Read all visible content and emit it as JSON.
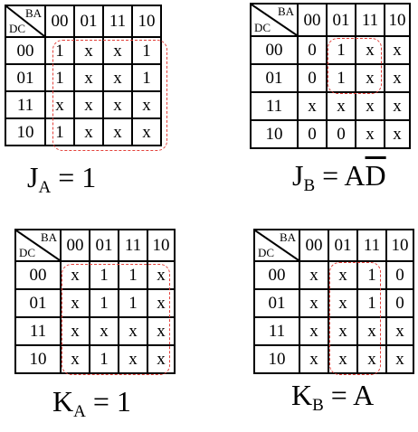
{
  "kmaps": [
    {
      "corner": {
        "top": "BA",
        "bottom": "DC"
      },
      "columns": [
        "00",
        "01",
        "11",
        "10"
      ],
      "rows": [
        {
          "label": "00",
          "cells": [
            "1",
            "x",
            "x",
            "1"
          ]
        },
        {
          "label": "01",
          "cells": [
            "1",
            "x",
            "x",
            "1"
          ]
        },
        {
          "label": "11",
          "cells": [
            "x",
            "x",
            "x",
            "x"
          ]
        },
        {
          "label": "10",
          "cells": [
            "1",
            "x",
            "x",
            "x"
          ]
        }
      ],
      "equation": {
        "lhs": "J",
        "sub": "A",
        "rhs": " = 1"
      },
      "group_color": "#e3413b"
    },
    {
      "corner": {
        "top": "BA",
        "bottom": "DC"
      },
      "columns": [
        "00",
        "01",
        "11",
        "10"
      ],
      "rows": [
        {
          "label": "00",
          "cells": [
            "0",
            "1",
            "x",
            "x"
          ]
        },
        {
          "label": "01",
          "cells": [
            "0",
            "1",
            "x",
            "x"
          ]
        },
        {
          "label": "11",
          "cells": [
            "x",
            "x",
            "x",
            "x"
          ]
        },
        {
          "label": "10",
          "cells": [
            "0",
            "0",
            "x",
            "x"
          ]
        }
      ],
      "equation": {
        "lhs": "J",
        "sub": "B",
        "rhs": " = A",
        "rhs_bar": "D"
      },
      "group_color": "#e3413b"
    },
    {
      "corner": {
        "top": "BA",
        "bottom": "DC"
      },
      "columns": [
        "00",
        "01",
        "11",
        "10"
      ],
      "rows": [
        {
          "label": "00",
          "cells": [
            "x",
            "1",
            "1",
            "x"
          ]
        },
        {
          "label": "01",
          "cells": [
            "x",
            "1",
            "1",
            "x"
          ]
        },
        {
          "label": "11",
          "cells": [
            "x",
            "x",
            "x",
            "x"
          ]
        },
        {
          "label": "10",
          "cells": [
            "x",
            "1",
            "x",
            "x"
          ]
        }
      ],
      "equation": {
        "lhs": "K",
        "sub": "A",
        "rhs": " = 1"
      },
      "group_color": "#e3413b"
    },
    {
      "corner": {
        "top": "BA",
        "bottom": "DC"
      },
      "columns": [
        "00",
        "01",
        "11",
        "10"
      ],
      "rows": [
        {
          "label": "00",
          "cells": [
            "x",
            "x",
            "1",
            "0"
          ]
        },
        {
          "label": "01",
          "cells": [
            "x",
            "x",
            "1",
            "0"
          ]
        },
        {
          "label": "11",
          "cells": [
            "x",
            "x",
            "x",
            "x"
          ]
        },
        {
          "label": "10",
          "cells": [
            "x",
            "x",
            "x",
            "x"
          ]
        }
      ],
      "equation": {
        "lhs": "K",
        "sub": "B",
        "rhs": " = A"
      },
      "group_color": "#e3413b"
    }
  ]
}
